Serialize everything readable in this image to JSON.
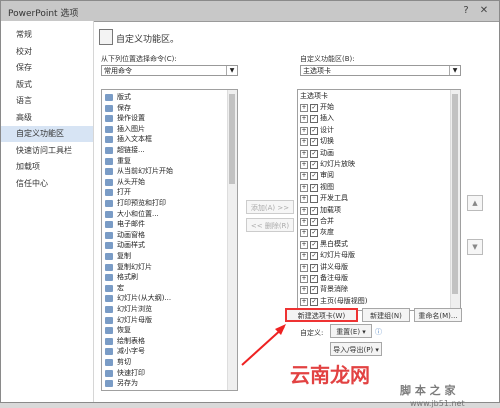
{
  "window": {
    "title": "PowerPoint 选项",
    "help_icon": "?",
    "close_icon": "✕"
  },
  "nav": {
    "items": [
      "常规",
      "校对",
      "保存",
      "版式",
      "语言",
      "高级",
      "自定义功能区",
      "快速访问工具栏",
      "加载项",
      "信任中心"
    ],
    "active": "自定义功能区"
  },
  "header": {
    "title": "自定义功能区。"
  },
  "left_panel": {
    "label": "从下列位置选择命令(C):",
    "select_value": "常用命令",
    "items": [
      "版式",
      "保存",
      "操作设置",
      "插入图片",
      "插入文本框",
      "超链接...",
      "重复",
      "从当前幻灯片开始",
      "从头开始",
      "打开",
      "打印预览和打印",
      "大小和位置...",
      "电子邮件",
      "动画窗格",
      "动画样式",
      "复制",
      "复制幻灯片",
      "格式刷",
      "宏",
      "幻灯片(从大纲)...",
      "幻灯片浏览",
      "幻灯片母版",
      "恢复",
      "绘制表格",
      "减小字号",
      "剪切",
      "快速打印",
      "另存为"
    ]
  },
  "middle_buttons": {
    "add": "添加(A) >>",
    "remove": "<< 删除(R)"
  },
  "right_panel": {
    "label": "自定义功能区(B):",
    "select_value": "主选项卡",
    "tree_header": "主选项卡",
    "items": [
      {
        "label": "开始",
        "checked": true
      },
      {
        "label": "插入",
        "checked": true
      },
      {
        "label": "设计",
        "checked": true
      },
      {
        "label": "切换",
        "checked": true
      },
      {
        "label": "动画",
        "checked": true
      },
      {
        "label": "幻灯片放映",
        "checked": true
      },
      {
        "label": "审阅",
        "checked": true
      },
      {
        "label": "视图",
        "checked": true
      },
      {
        "label": "开发工具",
        "checked": false
      },
      {
        "label": "加载项",
        "checked": true
      },
      {
        "label": "合并",
        "checked": true
      },
      {
        "label": "灰度",
        "checked": true
      },
      {
        "label": "黑白模式",
        "checked": true
      },
      {
        "label": "幻灯片母版",
        "checked": true
      },
      {
        "label": "讲义母版",
        "checked": true
      },
      {
        "label": "备注母版",
        "checked": true
      },
      {
        "label": "背景消除",
        "checked": true
      },
      {
        "label": "主页(母版视图)",
        "checked": true
      }
    ]
  },
  "bottom_buttons": {
    "new_tab": "新建选项卡(W)",
    "new_group": "新建组(N)",
    "rename": "重命名(M)..."
  },
  "customize": {
    "label": "自定义:",
    "reset": "重置(E) ▾",
    "import_export": "导入/导出(P) ▾"
  },
  "watermark": {
    "text1": "云南龙网",
    "text2": "脚 本 之 家",
    "text3": "www.jb51.net"
  }
}
